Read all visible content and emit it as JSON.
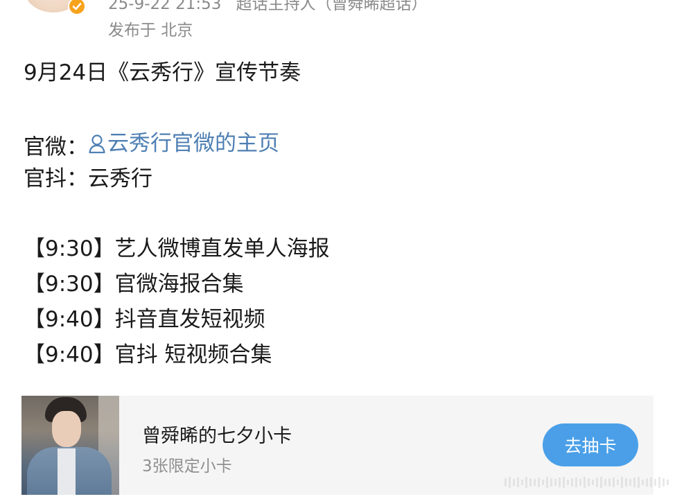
{
  "header": {
    "timestamp": "25-9-22 21:53",
    "source": "超话主持人（曾舜晞超话）",
    "location": "发布于 北京"
  },
  "post": {
    "title": "9月24日《云秀行》宣传节奏",
    "guanwei_label": "官微：",
    "guanwei_link": "云秀行官微的主页",
    "guandou_label": "官抖：",
    "guandou_value": "云秀行",
    "schedule": [
      {
        "time": "【9:30】",
        "text": "艺人微博直发单人海报"
      },
      {
        "time": "【9:30】",
        "text": "官微海报合集"
      },
      {
        "time": "【9:40】",
        "text": "抖音直发短视频"
      },
      {
        "time": "【9:40】",
        "text": "官抖 短视频合集"
      }
    ]
  },
  "card": {
    "title": "曾舜晞的七夕小卡",
    "subtitle": "3张限定小卡",
    "button_label": "去抽卡"
  },
  "icons": {
    "verified": "verified-badge-icon",
    "person": "person-icon"
  },
  "colors": {
    "link": "#4e7fb3",
    "button": "#4a9fe8",
    "badge": "#f7a31c",
    "meta": "#8a8a8a"
  }
}
